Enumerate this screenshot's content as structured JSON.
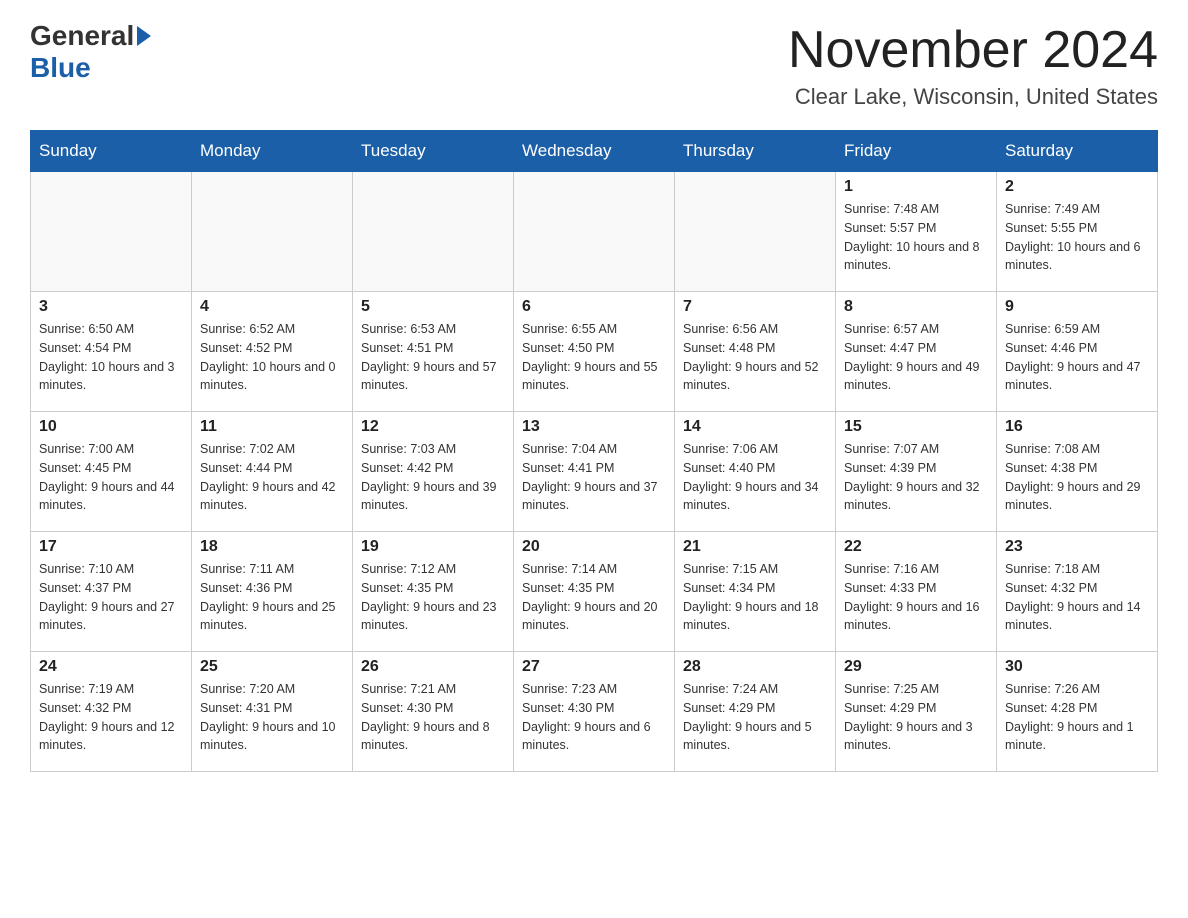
{
  "logo": {
    "general": "General",
    "blue": "Blue"
  },
  "header": {
    "title": "November 2024",
    "subtitle": "Clear Lake, Wisconsin, United States"
  },
  "days_of_week": [
    "Sunday",
    "Monday",
    "Tuesday",
    "Wednesday",
    "Thursday",
    "Friday",
    "Saturday"
  ],
  "weeks": [
    [
      {
        "day": "",
        "sunrise": "",
        "sunset": "",
        "daylight": ""
      },
      {
        "day": "",
        "sunrise": "",
        "sunset": "",
        "daylight": ""
      },
      {
        "day": "",
        "sunrise": "",
        "sunset": "",
        "daylight": ""
      },
      {
        "day": "",
        "sunrise": "",
        "sunset": "",
        "daylight": ""
      },
      {
        "day": "",
        "sunrise": "",
        "sunset": "",
        "daylight": ""
      },
      {
        "day": "1",
        "sunrise": "Sunrise: 7:48 AM",
        "sunset": "Sunset: 5:57 PM",
        "daylight": "Daylight: 10 hours and 8 minutes."
      },
      {
        "day": "2",
        "sunrise": "Sunrise: 7:49 AM",
        "sunset": "Sunset: 5:55 PM",
        "daylight": "Daylight: 10 hours and 6 minutes."
      }
    ],
    [
      {
        "day": "3",
        "sunrise": "Sunrise: 6:50 AM",
        "sunset": "Sunset: 4:54 PM",
        "daylight": "Daylight: 10 hours and 3 minutes."
      },
      {
        "day": "4",
        "sunrise": "Sunrise: 6:52 AM",
        "sunset": "Sunset: 4:52 PM",
        "daylight": "Daylight: 10 hours and 0 minutes."
      },
      {
        "day": "5",
        "sunrise": "Sunrise: 6:53 AM",
        "sunset": "Sunset: 4:51 PM",
        "daylight": "Daylight: 9 hours and 57 minutes."
      },
      {
        "day": "6",
        "sunrise": "Sunrise: 6:55 AM",
        "sunset": "Sunset: 4:50 PM",
        "daylight": "Daylight: 9 hours and 55 minutes."
      },
      {
        "day": "7",
        "sunrise": "Sunrise: 6:56 AM",
        "sunset": "Sunset: 4:48 PM",
        "daylight": "Daylight: 9 hours and 52 minutes."
      },
      {
        "day": "8",
        "sunrise": "Sunrise: 6:57 AM",
        "sunset": "Sunset: 4:47 PM",
        "daylight": "Daylight: 9 hours and 49 minutes."
      },
      {
        "day": "9",
        "sunrise": "Sunrise: 6:59 AM",
        "sunset": "Sunset: 4:46 PM",
        "daylight": "Daylight: 9 hours and 47 minutes."
      }
    ],
    [
      {
        "day": "10",
        "sunrise": "Sunrise: 7:00 AM",
        "sunset": "Sunset: 4:45 PM",
        "daylight": "Daylight: 9 hours and 44 minutes."
      },
      {
        "day": "11",
        "sunrise": "Sunrise: 7:02 AM",
        "sunset": "Sunset: 4:44 PM",
        "daylight": "Daylight: 9 hours and 42 minutes."
      },
      {
        "day": "12",
        "sunrise": "Sunrise: 7:03 AM",
        "sunset": "Sunset: 4:42 PM",
        "daylight": "Daylight: 9 hours and 39 minutes."
      },
      {
        "day": "13",
        "sunrise": "Sunrise: 7:04 AM",
        "sunset": "Sunset: 4:41 PM",
        "daylight": "Daylight: 9 hours and 37 minutes."
      },
      {
        "day": "14",
        "sunrise": "Sunrise: 7:06 AM",
        "sunset": "Sunset: 4:40 PM",
        "daylight": "Daylight: 9 hours and 34 minutes."
      },
      {
        "day": "15",
        "sunrise": "Sunrise: 7:07 AM",
        "sunset": "Sunset: 4:39 PM",
        "daylight": "Daylight: 9 hours and 32 minutes."
      },
      {
        "day": "16",
        "sunrise": "Sunrise: 7:08 AM",
        "sunset": "Sunset: 4:38 PM",
        "daylight": "Daylight: 9 hours and 29 minutes."
      }
    ],
    [
      {
        "day": "17",
        "sunrise": "Sunrise: 7:10 AM",
        "sunset": "Sunset: 4:37 PM",
        "daylight": "Daylight: 9 hours and 27 minutes."
      },
      {
        "day": "18",
        "sunrise": "Sunrise: 7:11 AM",
        "sunset": "Sunset: 4:36 PM",
        "daylight": "Daylight: 9 hours and 25 minutes."
      },
      {
        "day": "19",
        "sunrise": "Sunrise: 7:12 AM",
        "sunset": "Sunset: 4:35 PM",
        "daylight": "Daylight: 9 hours and 23 minutes."
      },
      {
        "day": "20",
        "sunrise": "Sunrise: 7:14 AM",
        "sunset": "Sunset: 4:35 PM",
        "daylight": "Daylight: 9 hours and 20 minutes."
      },
      {
        "day": "21",
        "sunrise": "Sunrise: 7:15 AM",
        "sunset": "Sunset: 4:34 PM",
        "daylight": "Daylight: 9 hours and 18 minutes."
      },
      {
        "day": "22",
        "sunrise": "Sunrise: 7:16 AM",
        "sunset": "Sunset: 4:33 PM",
        "daylight": "Daylight: 9 hours and 16 minutes."
      },
      {
        "day": "23",
        "sunrise": "Sunrise: 7:18 AM",
        "sunset": "Sunset: 4:32 PM",
        "daylight": "Daylight: 9 hours and 14 minutes."
      }
    ],
    [
      {
        "day": "24",
        "sunrise": "Sunrise: 7:19 AM",
        "sunset": "Sunset: 4:32 PM",
        "daylight": "Daylight: 9 hours and 12 minutes."
      },
      {
        "day": "25",
        "sunrise": "Sunrise: 7:20 AM",
        "sunset": "Sunset: 4:31 PM",
        "daylight": "Daylight: 9 hours and 10 minutes."
      },
      {
        "day": "26",
        "sunrise": "Sunrise: 7:21 AM",
        "sunset": "Sunset: 4:30 PM",
        "daylight": "Daylight: 9 hours and 8 minutes."
      },
      {
        "day": "27",
        "sunrise": "Sunrise: 7:23 AM",
        "sunset": "Sunset: 4:30 PM",
        "daylight": "Daylight: 9 hours and 6 minutes."
      },
      {
        "day": "28",
        "sunrise": "Sunrise: 7:24 AM",
        "sunset": "Sunset: 4:29 PM",
        "daylight": "Daylight: 9 hours and 5 minutes."
      },
      {
        "day": "29",
        "sunrise": "Sunrise: 7:25 AM",
        "sunset": "Sunset: 4:29 PM",
        "daylight": "Daylight: 9 hours and 3 minutes."
      },
      {
        "day": "30",
        "sunrise": "Sunrise: 7:26 AM",
        "sunset": "Sunset: 4:28 PM",
        "daylight": "Daylight: 9 hours and 1 minute."
      }
    ]
  ]
}
